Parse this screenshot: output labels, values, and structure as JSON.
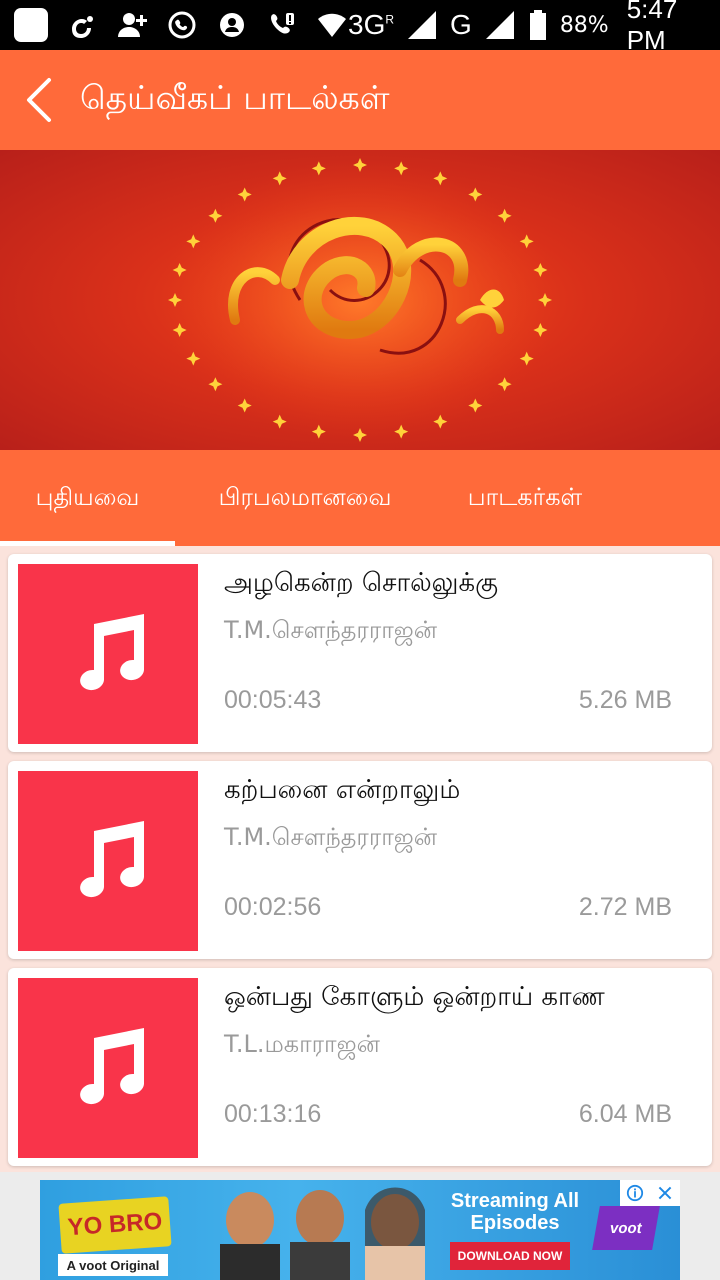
{
  "status_bar": {
    "network_label_1": "3G",
    "network_label_1_sup": "R",
    "network_label_2": "G",
    "battery_percent": "88%",
    "time": "5:47 PM"
  },
  "app_bar": {
    "title": "தெய்வீகப் பாடல்கள்"
  },
  "tabs": [
    {
      "label": "புதியவை",
      "active": true
    },
    {
      "label": "பிரபலமானவை",
      "active": false
    },
    {
      "label": "பாடகர்கள்",
      "active": false
    }
  ],
  "songs": [
    {
      "title": "அழகென்ற சொல்லுக்கு",
      "artist": "T.M.சௌந்தரராஜன்",
      "duration": "00:05:43",
      "size": "5.26 MB"
    },
    {
      "title": "கற்பனை என்றாலும்",
      "artist": "T.M.சௌந்தரராஜன்",
      "duration": "00:02:56",
      "size": "2.72 MB"
    },
    {
      "title": "ஒன்பது கோளும் ஒன்றாய் காண",
      "artist": "T.L.மகாராஜன்",
      "duration": "00:13:16",
      "size": "6.04 MB"
    }
  ],
  "ad": {
    "brand": "YO BRO",
    "brand_sub": "A voot Original",
    "headline": "Streaming All Episodes",
    "cta": "DOWNLOAD NOW",
    "network": "voot"
  },
  "colors": {
    "accent": "#ff6a3a",
    "thumb": "#f9344a",
    "background": "#fbe3dc"
  }
}
